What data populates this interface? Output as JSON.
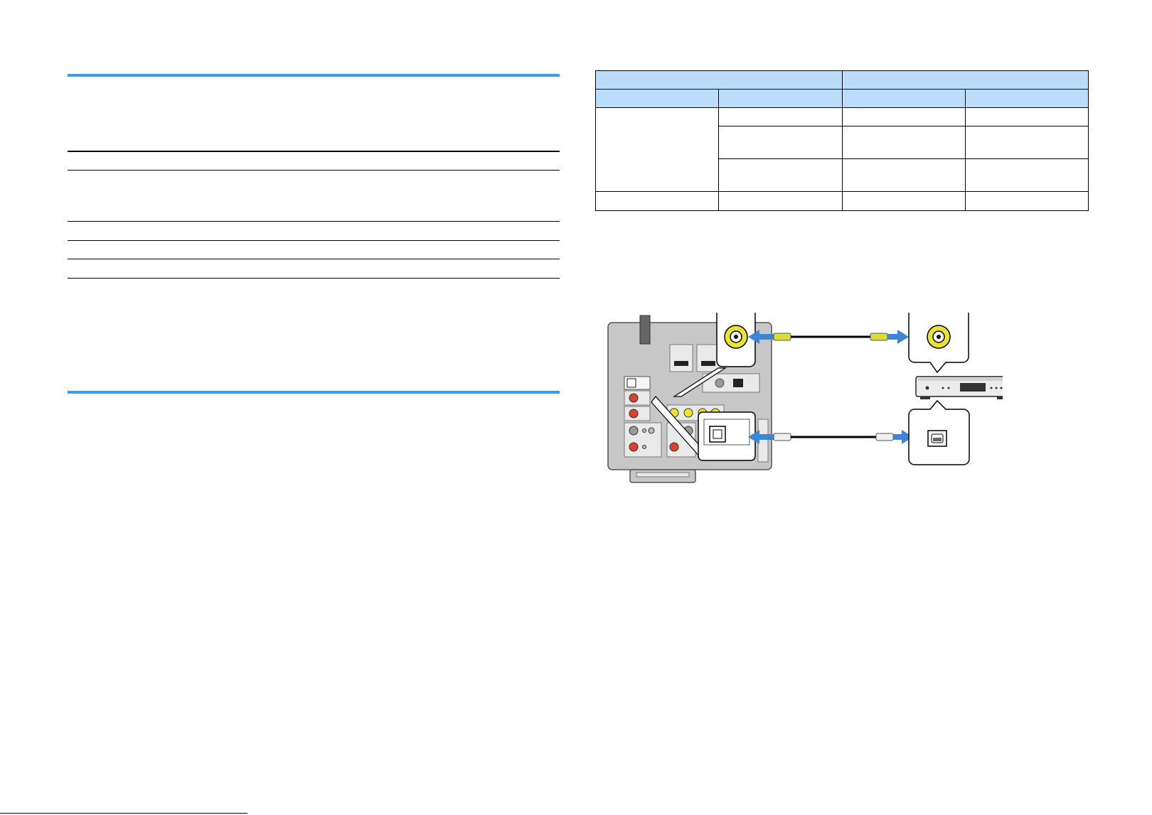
{
  "left_section": {
    "table_rows": [
      "",
      "",
      "",
      "",
      ""
    ]
  },
  "connection_table": {
    "header_groups": [
      "",
      ""
    ],
    "sub_headers": [
      "",
      "",
      "",
      ""
    ],
    "rows": [
      [
        "",
        "",
        "",
        ""
      ],
      [
        "",
        "",
        "",
        ""
      ],
      [
        "",
        "",
        "",
        ""
      ],
      [
        "",
        "",
        "",
        ""
      ]
    ]
  },
  "diagram": {
    "colors": {
      "arrow": "#3d86d6",
      "coax_cable": "#d9dc3a",
      "rca_yellow": "#ece42c",
      "rca_red": "#d8422b",
      "panel": "#c7c7c7"
    },
    "icons": [
      "av-receiver-rear-panel",
      "coaxial-jack-icon",
      "optical-jack-icon",
      "cd-player-icon",
      "coaxial-cable",
      "optical-cable"
    ]
  }
}
